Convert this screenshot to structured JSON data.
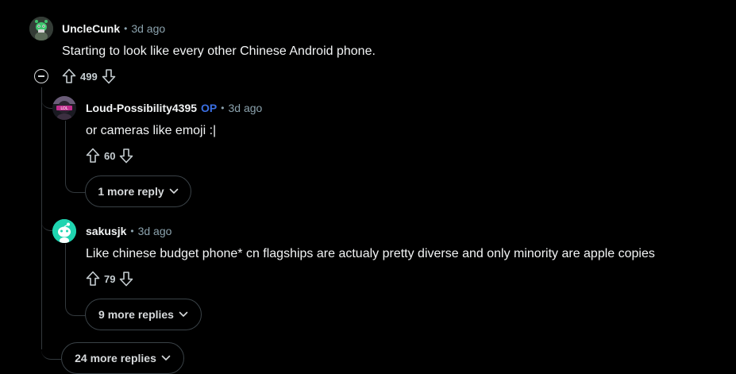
{
  "comments": {
    "top": {
      "author": "UncleCunk",
      "time": "3d ago",
      "text": "Starting to look like every other Chinese Android phone.",
      "score": "499"
    },
    "reply1": {
      "author": "Loud-Possibility4395",
      "op_badge": "OP",
      "time": "3d ago",
      "text": "or cameras like emoji :|",
      "score": "60",
      "more_label": "1 more reply"
    },
    "reply2": {
      "author": "sakusjk",
      "time": "3d ago",
      "text": "Like chinese budget phone* cn flagships are actualy pretty diverse and only minority are apple copies",
      "score": "79",
      "more_label": "9 more replies"
    },
    "more_top_label": "24 more replies"
  },
  "separator": "•",
  "colors": {
    "background": "#000000",
    "text": "#f2f4f5",
    "meta": "#8ba2ad",
    "op": "#3a6fe3",
    "thread_line": "#33393d",
    "avatar_teal": "#1fd4b0"
  },
  "icons": {
    "upvote": "upvote-arrow-icon",
    "downvote": "downvote-arrow-icon",
    "collapse": "collapse-minus-icon",
    "chevron": "chevron-down-icon"
  }
}
